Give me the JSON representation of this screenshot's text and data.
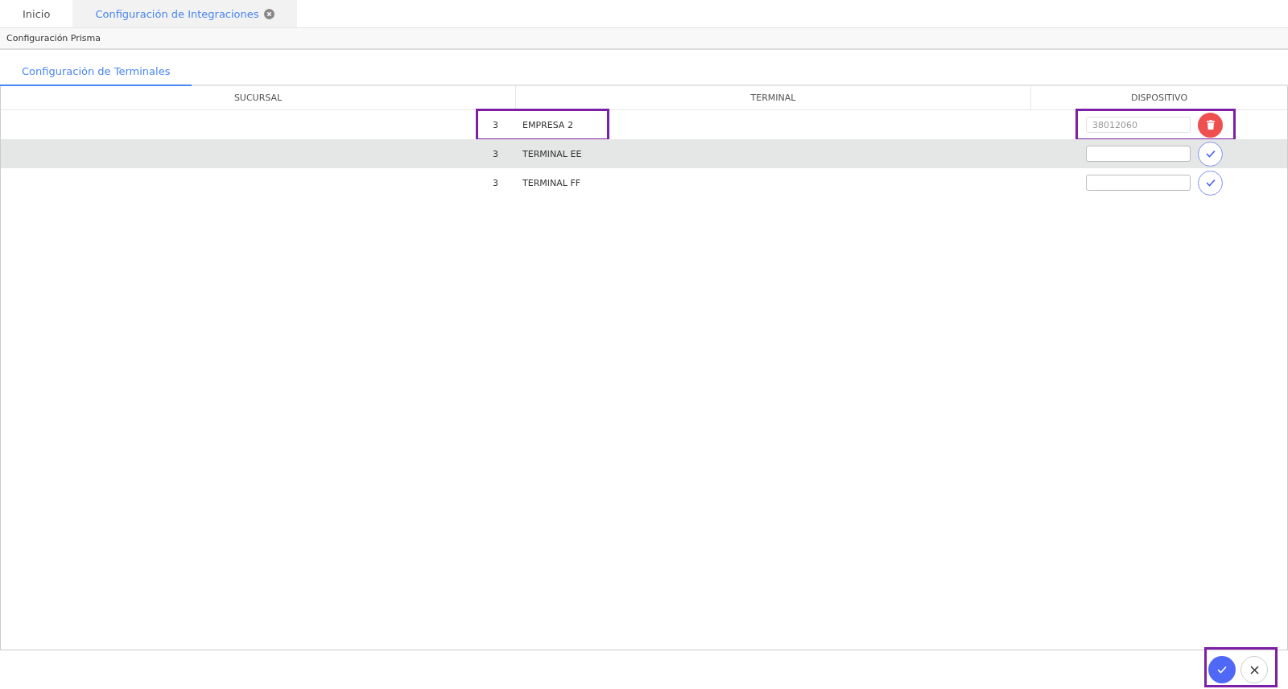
{
  "tabs": [
    {
      "label": "Inicio",
      "selected": false,
      "closable": false
    },
    {
      "label": "Configuración de Integraciones",
      "selected": true,
      "closable": true
    }
  ],
  "breadcrumb": "Configuración Prisma",
  "subtabs": [
    {
      "label": "Configuración de Terminales",
      "selected": true
    }
  ],
  "table": {
    "columns": [
      "SUCURSAL",
      "TERMINAL",
      "DISPOSITIVO"
    ],
    "rows": [
      {
        "sucursal": "3",
        "terminal": "EMPRESA 2",
        "kind": "saved",
        "device": "38012060",
        "selected": false,
        "marked": true
      },
      {
        "sucursal": "3",
        "terminal": "TERMINAL EE",
        "kind": "pending",
        "device": "",
        "selected": true,
        "marked": false
      },
      {
        "sucursal": "3",
        "terminal": "TERMINAL FF",
        "kind": "pending",
        "device": "",
        "selected": false,
        "marked": false
      }
    ]
  },
  "footer": {
    "marked": true
  }
}
